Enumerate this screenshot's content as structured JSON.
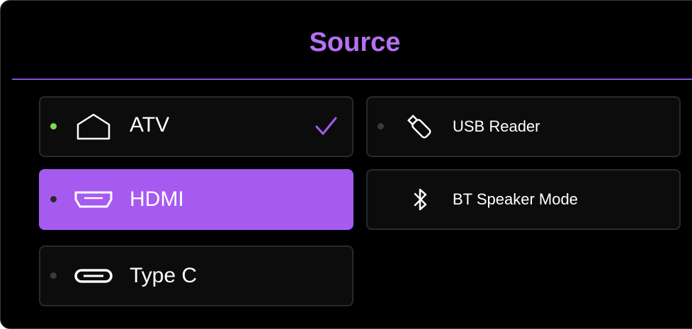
{
  "header": {
    "title": "Source"
  },
  "sources": [
    {
      "label": "ATV",
      "icon": "home-icon",
      "indicator": "#7ed957",
      "checked": true,
      "selected": false
    },
    {
      "label": "HDMI",
      "icon": "hdmi-icon",
      "indicator": "#2a2a2a",
      "checked": false,
      "selected": true
    },
    {
      "label": "Type C",
      "icon": "usb-c-icon",
      "indicator": "#3a3a3a",
      "checked": false,
      "selected": false
    },
    {
      "label": "USB Reader",
      "icon": "usb-stick-icon",
      "indicator": "#3a3a3a",
      "checked": false,
      "selected": false
    },
    {
      "label": "BT Speaker Mode",
      "icon": "bluetooth-icon",
      "checked": false,
      "selected": false
    }
  ],
  "colors": {
    "accent": "#b670f2",
    "selected_tile": "#a75af0",
    "active_indicator": "#7ed957"
  }
}
